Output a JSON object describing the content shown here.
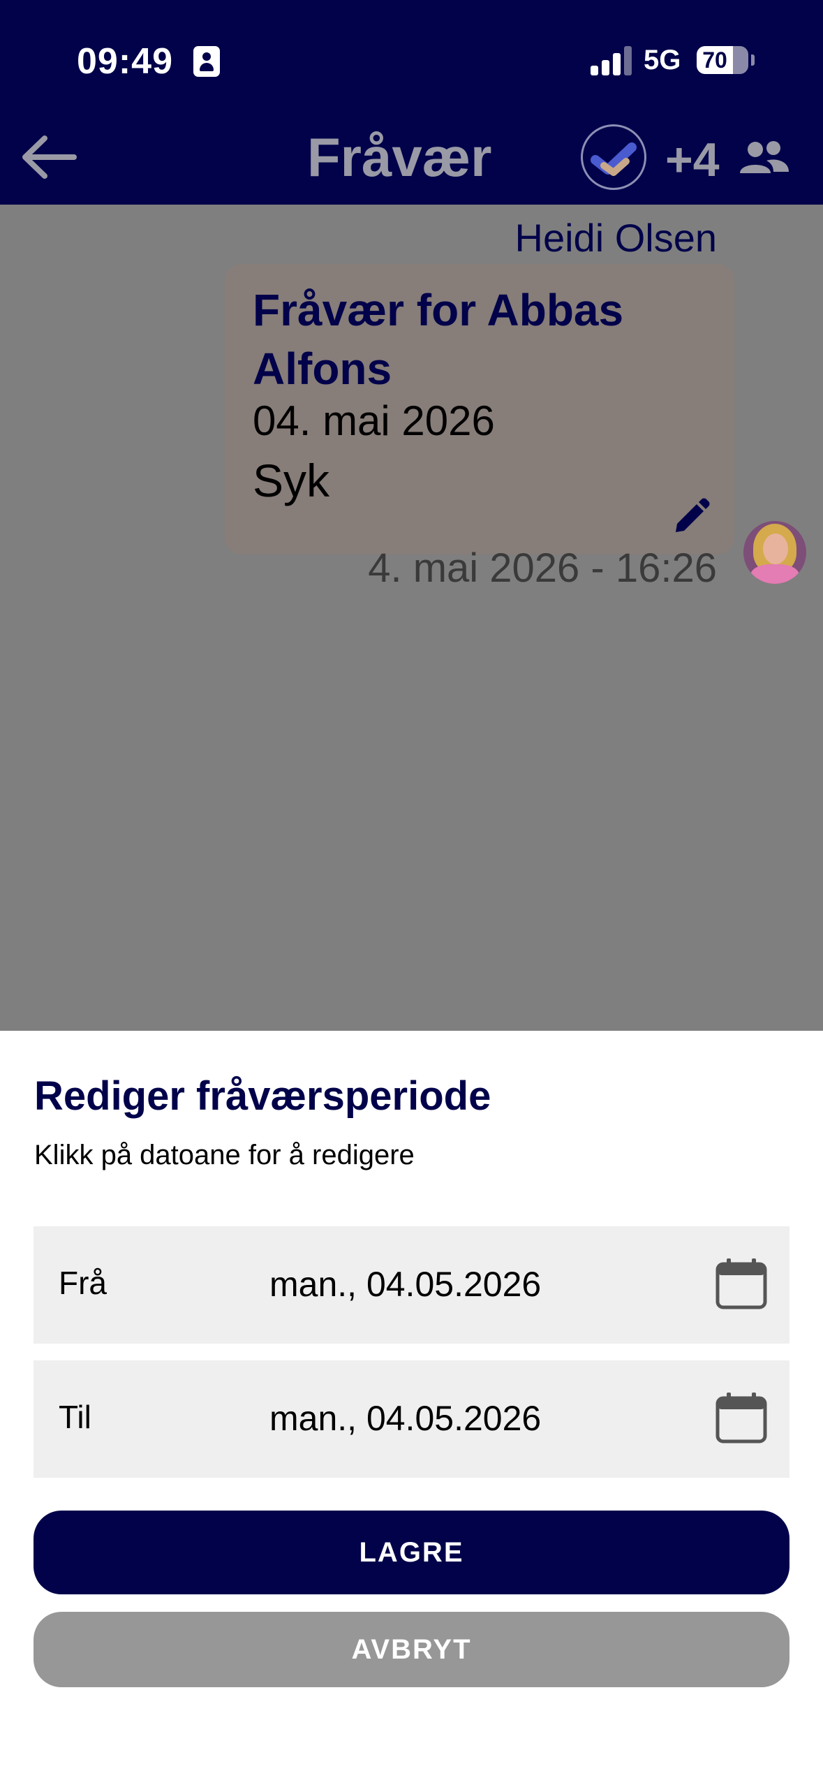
{
  "status_bar": {
    "time": "09:49",
    "network": "5G",
    "battery": "70",
    "battery_level": 0.7
  },
  "header": {
    "title": "Fråvær",
    "participants_extra": "+4",
    "icons": [
      "back-arrow-icon",
      "app-logo-icon",
      "group-icon"
    ],
    "background_color": "#01024a"
  },
  "message": {
    "sender": "Heidi Olsen",
    "title": "Fråvær for Abbas Alfons",
    "date": "04. mai 2026",
    "type": "Syk",
    "timestamp": "4. mai 2026 - 16:26",
    "icons": [
      "pencil-icon",
      "avatar"
    ]
  },
  "sheet": {
    "title": "Rediger fråværsperiode",
    "subtitle": "Klikk på datoane for å redigere",
    "fields": [
      {
        "label": "Frå",
        "value": "man., 04.05.2026",
        "icon": "calendar-icon"
      },
      {
        "label": "Til",
        "value": "man., 04.05.2026",
        "icon": "calendar-icon"
      }
    ],
    "save_label": "LAGRE",
    "cancel_label": "AVBRYT",
    "save_color": "#01024a",
    "cancel_color": "#979797"
  }
}
